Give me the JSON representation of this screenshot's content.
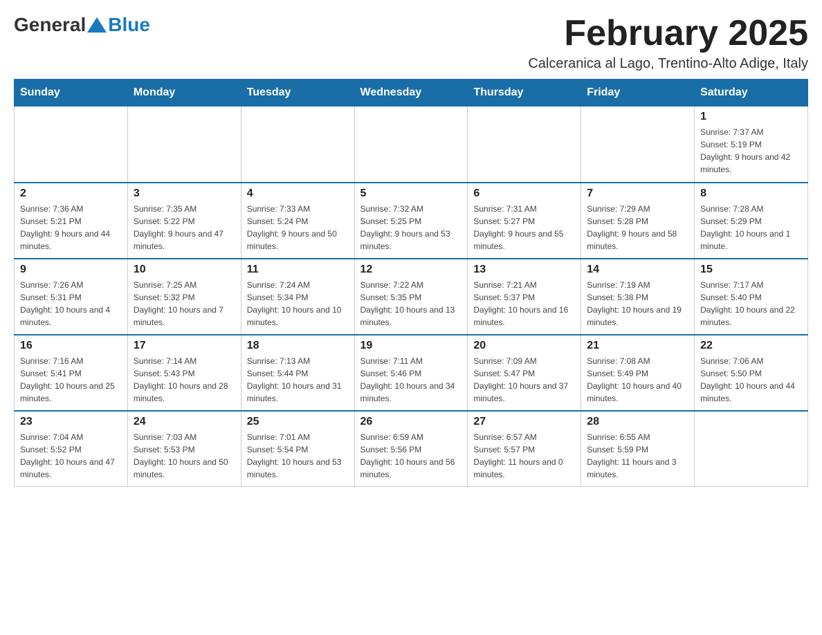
{
  "logo": {
    "general": "General",
    "blue": "Blue"
  },
  "title": {
    "month_year": "February 2025",
    "location": "Calceranica al Lago, Trentino-Alto Adige, Italy"
  },
  "days_of_week": [
    "Sunday",
    "Monday",
    "Tuesday",
    "Wednesday",
    "Thursday",
    "Friday",
    "Saturday"
  ],
  "weeks": [
    [
      {
        "day": "",
        "info": ""
      },
      {
        "day": "",
        "info": ""
      },
      {
        "day": "",
        "info": ""
      },
      {
        "day": "",
        "info": ""
      },
      {
        "day": "",
        "info": ""
      },
      {
        "day": "",
        "info": ""
      },
      {
        "day": "1",
        "info": "Sunrise: 7:37 AM\nSunset: 5:19 PM\nDaylight: 9 hours and 42 minutes."
      }
    ],
    [
      {
        "day": "2",
        "info": "Sunrise: 7:36 AM\nSunset: 5:21 PM\nDaylight: 9 hours and 44 minutes."
      },
      {
        "day": "3",
        "info": "Sunrise: 7:35 AM\nSunset: 5:22 PM\nDaylight: 9 hours and 47 minutes."
      },
      {
        "day": "4",
        "info": "Sunrise: 7:33 AM\nSunset: 5:24 PM\nDaylight: 9 hours and 50 minutes."
      },
      {
        "day": "5",
        "info": "Sunrise: 7:32 AM\nSunset: 5:25 PM\nDaylight: 9 hours and 53 minutes."
      },
      {
        "day": "6",
        "info": "Sunrise: 7:31 AM\nSunset: 5:27 PM\nDaylight: 9 hours and 55 minutes."
      },
      {
        "day": "7",
        "info": "Sunrise: 7:29 AM\nSunset: 5:28 PM\nDaylight: 9 hours and 58 minutes."
      },
      {
        "day": "8",
        "info": "Sunrise: 7:28 AM\nSunset: 5:29 PM\nDaylight: 10 hours and 1 minute."
      }
    ],
    [
      {
        "day": "9",
        "info": "Sunrise: 7:26 AM\nSunset: 5:31 PM\nDaylight: 10 hours and 4 minutes."
      },
      {
        "day": "10",
        "info": "Sunrise: 7:25 AM\nSunset: 5:32 PM\nDaylight: 10 hours and 7 minutes."
      },
      {
        "day": "11",
        "info": "Sunrise: 7:24 AM\nSunset: 5:34 PM\nDaylight: 10 hours and 10 minutes."
      },
      {
        "day": "12",
        "info": "Sunrise: 7:22 AM\nSunset: 5:35 PM\nDaylight: 10 hours and 13 minutes."
      },
      {
        "day": "13",
        "info": "Sunrise: 7:21 AM\nSunset: 5:37 PM\nDaylight: 10 hours and 16 minutes."
      },
      {
        "day": "14",
        "info": "Sunrise: 7:19 AM\nSunset: 5:38 PM\nDaylight: 10 hours and 19 minutes."
      },
      {
        "day": "15",
        "info": "Sunrise: 7:17 AM\nSunset: 5:40 PM\nDaylight: 10 hours and 22 minutes."
      }
    ],
    [
      {
        "day": "16",
        "info": "Sunrise: 7:16 AM\nSunset: 5:41 PM\nDaylight: 10 hours and 25 minutes."
      },
      {
        "day": "17",
        "info": "Sunrise: 7:14 AM\nSunset: 5:43 PM\nDaylight: 10 hours and 28 minutes."
      },
      {
        "day": "18",
        "info": "Sunrise: 7:13 AM\nSunset: 5:44 PM\nDaylight: 10 hours and 31 minutes."
      },
      {
        "day": "19",
        "info": "Sunrise: 7:11 AM\nSunset: 5:46 PM\nDaylight: 10 hours and 34 minutes."
      },
      {
        "day": "20",
        "info": "Sunrise: 7:09 AM\nSunset: 5:47 PM\nDaylight: 10 hours and 37 minutes."
      },
      {
        "day": "21",
        "info": "Sunrise: 7:08 AM\nSunset: 5:49 PM\nDaylight: 10 hours and 40 minutes."
      },
      {
        "day": "22",
        "info": "Sunrise: 7:06 AM\nSunset: 5:50 PM\nDaylight: 10 hours and 44 minutes."
      }
    ],
    [
      {
        "day": "23",
        "info": "Sunrise: 7:04 AM\nSunset: 5:52 PM\nDaylight: 10 hours and 47 minutes."
      },
      {
        "day": "24",
        "info": "Sunrise: 7:03 AM\nSunset: 5:53 PM\nDaylight: 10 hours and 50 minutes."
      },
      {
        "day": "25",
        "info": "Sunrise: 7:01 AM\nSunset: 5:54 PM\nDaylight: 10 hours and 53 minutes."
      },
      {
        "day": "26",
        "info": "Sunrise: 6:59 AM\nSunset: 5:56 PM\nDaylight: 10 hours and 56 minutes."
      },
      {
        "day": "27",
        "info": "Sunrise: 6:57 AM\nSunset: 5:57 PM\nDaylight: 11 hours and 0 minutes."
      },
      {
        "day": "28",
        "info": "Sunrise: 6:55 AM\nSunset: 5:59 PM\nDaylight: 11 hours and 3 minutes."
      },
      {
        "day": "",
        "info": ""
      }
    ]
  ],
  "colors": {
    "header_bg": "#1a6ea8",
    "header_text": "#ffffff",
    "border": "#cccccc",
    "day_number": "#222222",
    "day_info": "#444444"
  }
}
